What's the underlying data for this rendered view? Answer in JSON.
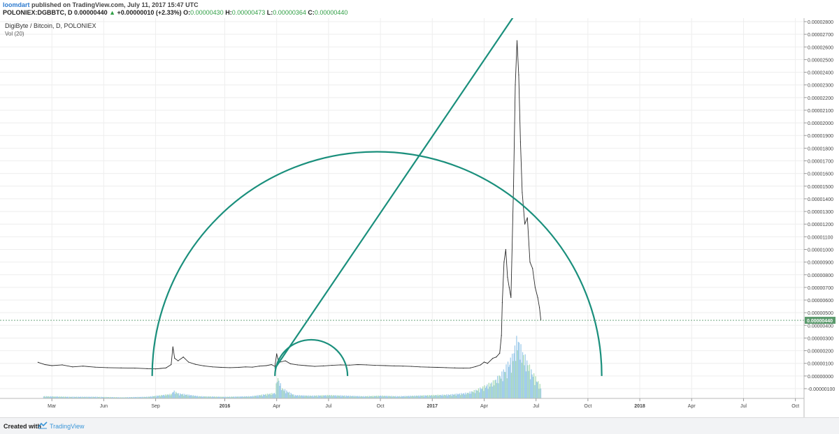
{
  "header": {
    "author": "loomdart",
    "published": "published on TradingView.com, July 11, 2017 15:47 UTC",
    "symbol": "POLONIEX:DGBBTC, D",
    "last": "0.00000440",
    "change": "+0.00000010 (+2.33%)",
    "open_label": "O:",
    "open": "0.00000430",
    "high_label": "H:",
    "high": "0.00000473",
    "low_label": "L:",
    "low": "0.00000364",
    "close_label": "C:",
    "close": "0.00000440"
  },
  "footer": {
    "created_with": "Created with",
    "brand": "TradingView"
  },
  "colors": {
    "drawing": "#1a8f7c",
    "volume": "#8fc3e8",
    "price_badge": "#5b9a6d"
  },
  "chart_data": {
    "type": "line",
    "title": "DigiByte / Bitcoin, D, POLONIEX",
    "subtitle": "Vol (20)",
    "current_price_label": "0.00000440",
    "y_tick_labels": [
      "0.00002800",
      "0.00002700",
      "0.00002600",
      "0.00002500",
      "0.00002400",
      "0.00002300",
      "0.00002200",
      "0.00002100",
      "0.00002000",
      "0.00001900",
      "0.00001800",
      "0.00001700",
      "0.00001600",
      "0.00001500",
      "0.00001400",
      "0.00001300",
      "0.00001200",
      "0.00001100",
      "0.00001000",
      "0.00000900",
      "0.00000800",
      "0.00000700",
      "0.00000600",
      "0.00000500",
      "0.00000400",
      "0.00000300",
      "0.00000200",
      "0.00000100",
      "0.00000000",
      "-0.00000100"
    ],
    "y_tick_values": [
      2800,
      2700,
      2600,
      2500,
      2400,
      2300,
      2200,
      2100,
      2000,
      1900,
      1800,
      1700,
      1600,
      1500,
      1400,
      1300,
      1200,
      1100,
      1000,
      900,
      800,
      700,
      600,
      500,
      400,
      300,
      200,
      100,
      0,
      -100
    ],
    "y_unit": "satoshi (1e-8 BTC)",
    "ylim": [
      -100,
      2800
    ],
    "x_tick_labels": [
      "Mar",
      "Jun",
      "Sep",
      "2016",
      "Apr",
      "Jul",
      "Oct",
      "2017",
      "Apr",
      "Jul",
      "Oct",
      "2018",
      "Apr",
      "Jul",
      "Oct"
    ],
    "x_tick_months": [
      2,
      5,
      8,
      12,
      15,
      18,
      21,
      24,
      27,
      30,
      33,
      36,
      39,
      42,
      45
    ],
    "x_range_months": [
      -1,
      45.5
    ],
    "price_series": [
      [
        1.2,
        108
      ],
      [
        1.6,
        90
      ],
      [
        2.0,
        82
      ],
      [
        2.6,
        88
      ],
      [
        3.2,
        72
      ],
      [
        3.8,
        78
      ],
      [
        4.5,
        70
      ],
      [
        5.2,
        66
      ],
      [
        6.0,
        64
      ],
      [
        6.8,
        62
      ],
      [
        7.5,
        58
      ],
      [
        8.0,
        56
      ],
      [
        8.3,
        60
      ],
      [
        8.6,
        64
      ],
      [
        8.9,
        90
      ],
      [
        9.0,
        230
      ],
      [
        9.1,
        140
      ],
      [
        9.3,
        120
      ],
      [
        9.6,
        150
      ],
      [
        9.9,
        110
      ],
      [
        10.3,
        92
      ],
      [
        10.8,
        80
      ],
      [
        11.3,
        72
      ],
      [
        11.8,
        68
      ],
      [
        12.3,
        66
      ],
      [
        12.8,
        68
      ],
      [
        13.2,
        72
      ],
      [
        13.6,
        70
      ],
      [
        14.0,
        78
      ],
      [
        14.4,
        82
      ],
      [
        14.7,
        90
      ],
      [
        14.9,
        76
      ],
      [
        15.0,
        175
      ],
      [
        15.1,
        120
      ],
      [
        15.2,
        110
      ],
      [
        15.5,
        120
      ],
      [
        15.8,
        96
      ],
      [
        16.2,
        88
      ],
      [
        16.7,
        82
      ],
      [
        17.2,
        76
      ],
      [
        17.7,
        80
      ],
      [
        18.2,
        84
      ],
      [
        18.7,
        88
      ],
      [
        19.2,
        86
      ],
      [
        19.7,
        90
      ],
      [
        20.2,
        88
      ],
      [
        20.7,
        84
      ],
      [
        21.3,
        82
      ],
      [
        21.8,
        80
      ],
      [
        22.3,
        78
      ],
      [
        22.8,
        76
      ],
      [
        23.3,
        72
      ],
      [
        23.8,
        70
      ],
      [
        24.3,
        68
      ],
      [
        24.8,
        66
      ],
      [
        25.3,
        64
      ],
      [
        25.8,
        62
      ],
      [
        26.2,
        64
      ],
      [
        26.5,
        74
      ],
      [
        26.8,
        88
      ],
      [
        27.0,
        110
      ],
      [
        27.2,
        100
      ],
      [
        27.5,
        140
      ],
      [
        27.7,
        150
      ],
      [
        27.9,
        180
      ],
      [
        28.0,
        320
      ],
      [
        28.05,
        580
      ],
      [
        28.15,
        900
      ],
      [
        28.25,
        1000
      ],
      [
        28.35,
        780
      ],
      [
        28.45,
        700
      ],
      [
        28.55,
        620
      ],
      [
        28.7,
        1500
      ],
      [
        28.8,
        2300
      ],
      [
        28.9,
        2650
      ],
      [
        29.0,
        2380
      ],
      [
        29.1,
        1850
      ],
      [
        29.2,
        1450
      ],
      [
        29.35,
        1200
      ],
      [
        29.5,
        1250
      ],
      [
        29.65,
        900
      ],
      [
        29.8,
        850
      ],
      [
        29.95,
        700
      ],
      [
        30.1,
        620
      ],
      [
        30.2,
        540
      ],
      [
        30.28,
        440
      ]
    ],
    "volume_series": [
      [
        1.5,
        4
      ],
      [
        3,
        3
      ],
      [
        4.5,
        3
      ],
      [
        6,
        2
      ],
      [
        7.5,
        3
      ],
      [
        8.9,
        8
      ],
      [
        9.0,
        14
      ],
      [
        9.3,
        9
      ],
      [
        10.5,
        4
      ],
      [
        12,
        3
      ],
      [
        13.5,
        4
      ],
      [
        14.9,
        10
      ],
      [
        15.0,
        40
      ],
      [
        15.3,
        18
      ],
      [
        16,
        6
      ],
      [
        17,
        5
      ],
      [
        18,
        6
      ],
      [
        19,
        5
      ],
      [
        20,
        4
      ],
      [
        21,
        5
      ],
      [
        22,
        4
      ],
      [
        23,
        5
      ],
      [
        24,
        6
      ],
      [
        25,
        7
      ],
      [
        26,
        10
      ],
      [
        26.5,
        15
      ],
      [
        27,
        22
      ],
      [
        27.5,
        30
      ],
      [
        28,
        45
      ],
      [
        28.3,
        60
      ],
      [
        28.6,
        75
      ],
      [
        28.9,
        110
      ],
      [
        29.1,
        90
      ],
      [
        29.4,
        70
      ],
      [
        29.7,
        50
      ],
      [
        30,
        35
      ],
      [
        30.28,
        20
      ]
    ],
    "volume_max": 110,
    "annotations": [
      {
        "shape": "arc",
        "center": [
          20.8,
          0
        ],
        "radius_months": 13.0,
        "note": "large Fibonacci-style arc from the low"
      },
      {
        "shape": "trend_line",
        "from": [
          14.9,
          60
        ],
        "to": [
          29.0,
          2900
        ]
      },
      {
        "shape": "arc",
        "center": [
          17.0,
          0
        ],
        "radius_months": 2.1,
        "note": "small arc near the 2016 base"
      }
    ]
  }
}
